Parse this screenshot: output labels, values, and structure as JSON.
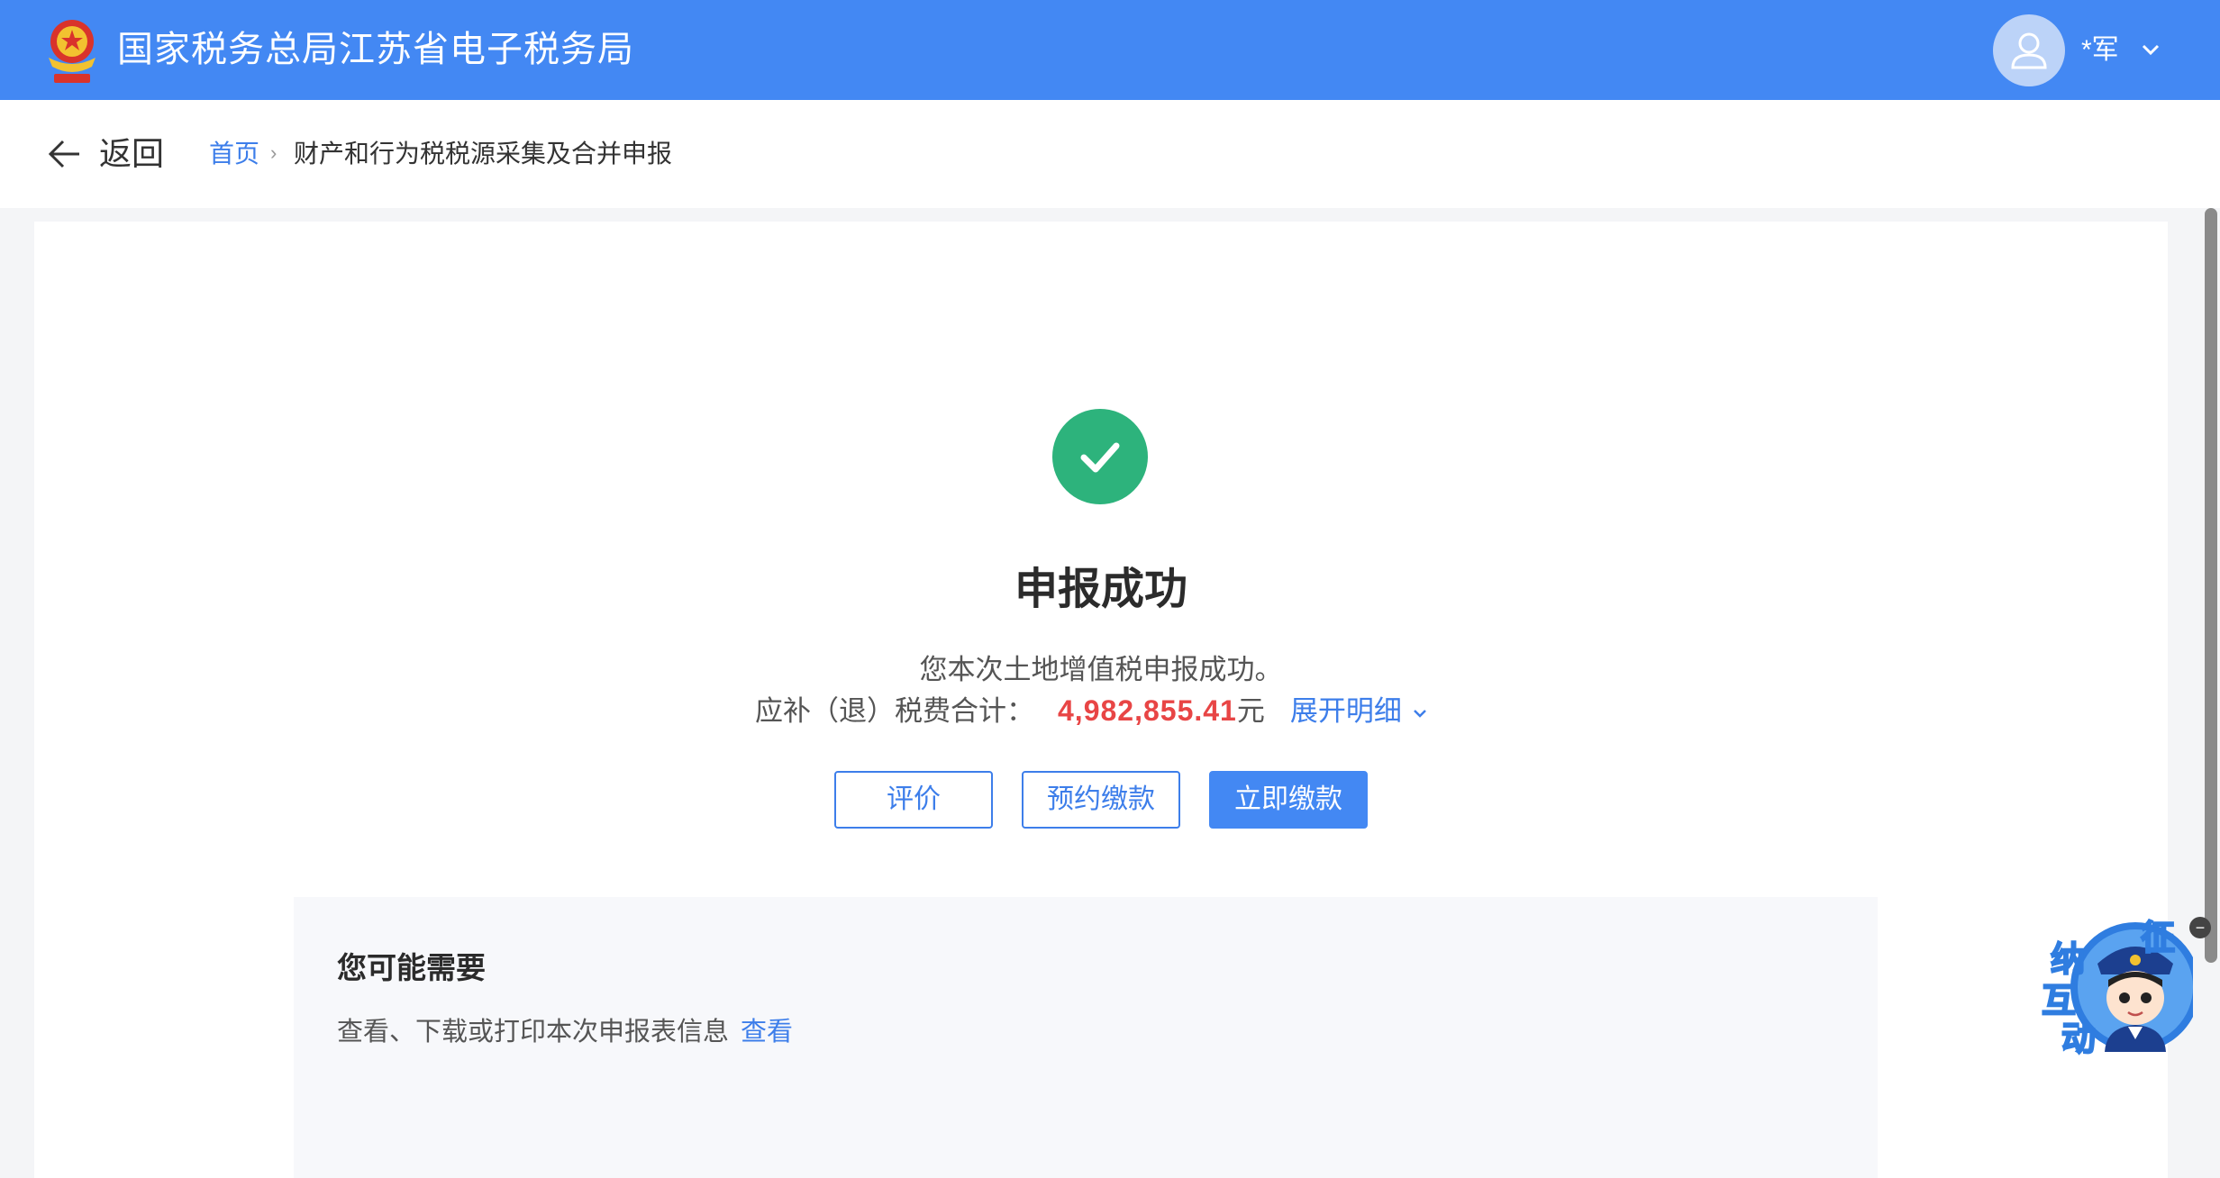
{
  "header": {
    "site_title": "国家税务总局江苏省电子税务局",
    "user_name": "*军",
    "brand_color": "#4388f3"
  },
  "nav": {
    "back_label": "返回",
    "breadcrumb_home": "首页",
    "breadcrumb_separator": "›",
    "breadcrumb_current": "财产和行为税税源采集及合并申报"
  },
  "result": {
    "title": "申报成功",
    "description": "您本次土地增值税申报成功。",
    "total_label": "应补（退）税费合计：",
    "total_amount": "4,982,855.41",
    "total_unit": "元",
    "expand_label": "展开明细",
    "success_color": "#2db37c",
    "amount_color": "#e84545"
  },
  "actions": {
    "evaluate_label": "评价",
    "schedule_pay_label": "预约缴款",
    "pay_now_label": "立即缴款"
  },
  "suggestions": {
    "title": "您可能需要",
    "item_text": "查看、下载或打印本次申报表信息",
    "item_link": "查看"
  },
  "assistant": {
    "label_chars": [
      "征",
      "纳",
      "互",
      "动"
    ],
    "close_symbol": "−"
  }
}
